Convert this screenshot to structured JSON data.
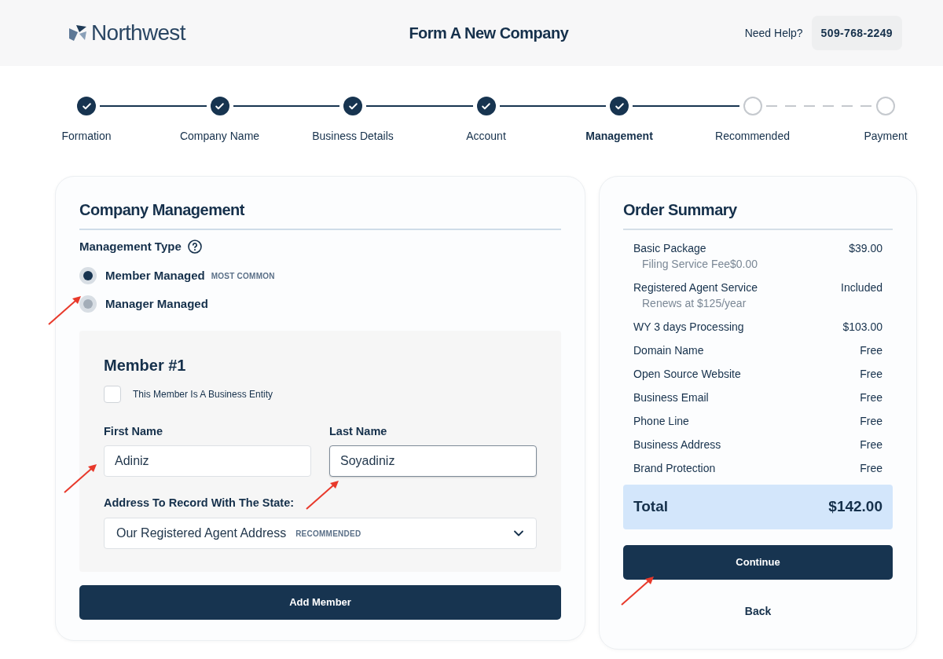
{
  "header": {
    "logo": {
      "text": "Northwest"
    },
    "title": "Form A New Company",
    "help_label": "Need Help?",
    "phone": "509-768-2249"
  },
  "steps": [
    {
      "label": "Formation",
      "completed": true,
      "selected": false
    },
    {
      "label": "Company Name",
      "completed": true,
      "selected": false
    },
    {
      "label": "Business Details",
      "completed": true,
      "selected": false
    },
    {
      "label": "Account",
      "completed": true,
      "selected": false
    },
    {
      "label": "Management",
      "completed": true,
      "selected": true
    },
    {
      "label": "Recommended",
      "completed": false,
      "selected": false
    },
    {
      "label": "Payment",
      "completed": false,
      "selected": false
    }
  ],
  "company_management": {
    "title": "Company Management",
    "management_type": {
      "label": "Management Type",
      "options": [
        {
          "label": "Member Managed",
          "badge": "MOST COMMON",
          "selected": true
        },
        {
          "label": "Manager Managed",
          "selected": false,
          "arrow": true
        }
      ]
    },
    "member": {
      "title": "Member #1",
      "business_entity": {
        "label": "This Member Is A Business Entity",
        "checked": false
      },
      "first_name": {
        "label": "First Name",
        "value": "Adiniz",
        "focused": false,
        "arrow": true
      },
      "last_name": {
        "label": "Last Name",
        "value": "Soyadiniz",
        "focused": true,
        "arrow": true
      },
      "address": {
        "label": "Address To Record With The State:",
        "value": "Our Registered Agent Address",
        "badge": "RECOMMENDED"
      }
    },
    "add_member_button": "Add Member"
  },
  "order_summary": {
    "title": "Order Summary",
    "items": [
      {
        "name": "Basic Package",
        "price": "$39.00",
        "note": "Filing Service Fee$0.00"
      },
      {
        "name": "Registered Agent Service",
        "price": "Included",
        "note": "Renews at $125/year"
      },
      {
        "name": "WY 3 days Processing",
        "price": "$103.00"
      },
      {
        "name": "Domain Name",
        "price": "Free"
      },
      {
        "name": "Open Source Website",
        "price": "Free"
      },
      {
        "name": "Business Email",
        "price": "Free"
      },
      {
        "name": "Phone Line",
        "price": "Free"
      },
      {
        "name": "Business Address",
        "price": "Free"
      },
      {
        "name": "Brand Protection",
        "price": "Free"
      }
    ],
    "total": {
      "label": "Total",
      "value": "$142.00"
    },
    "continue_button": {
      "label": "Continue",
      "arrow": true
    },
    "back_button": "Back"
  }
}
